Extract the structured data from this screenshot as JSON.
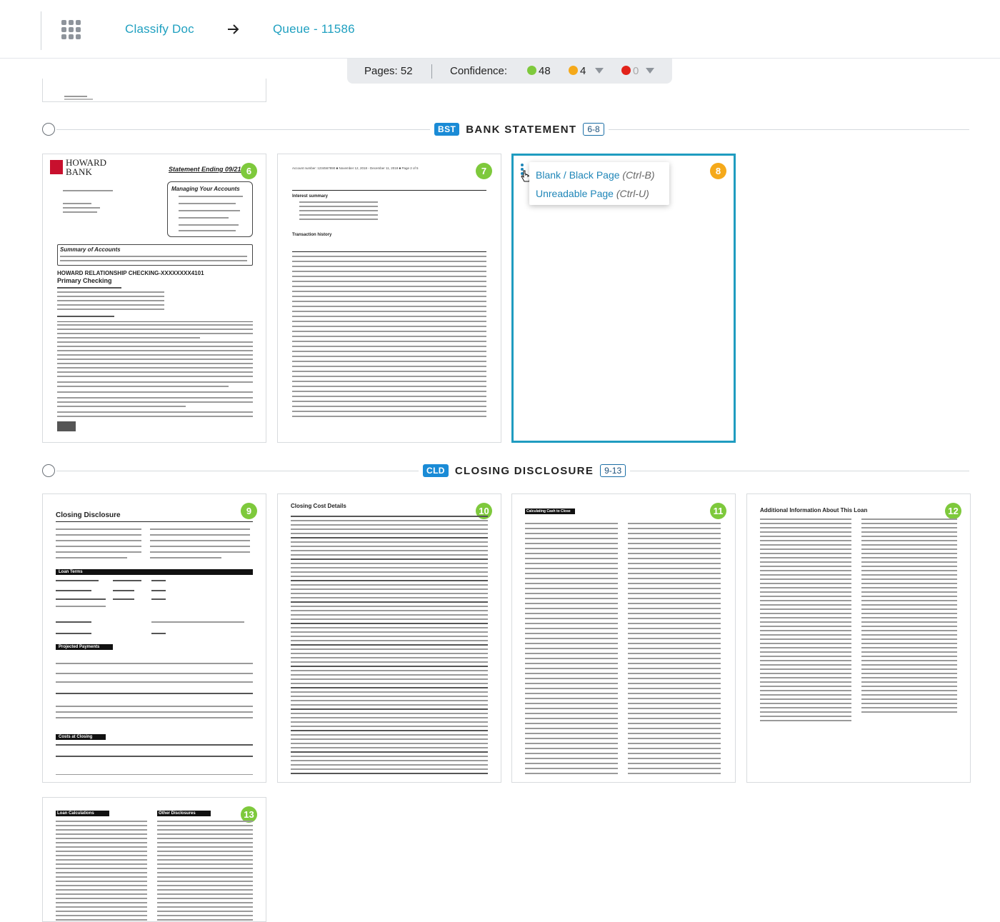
{
  "header": {
    "breadcrumb_1": "Classify Doc",
    "breadcrumb_2": "Queue - 11586"
  },
  "status": {
    "pages_label": "Pages: 52",
    "confidence_label": "Confidence:",
    "green_count": "48",
    "orange_count": "4",
    "red_count": "0",
    "colors": {
      "green": "#7ec93c",
      "orange": "#f5a91a",
      "red": "#e2231a"
    }
  },
  "sections": [
    {
      "code": "BST",
      "title": "BANK STATEMENT",
      "range": "6-8"
    },
    {
      "code": "CLD",
      "title": "CLOSING DISCLOSURE",
      "range": "9-13"
    }
  ],
  "pages": {
    "p6": "6",
    "p7": "7",
    "p8": "8",
    "p9": "9",
    "p10": "10",
    "p11": "11",
    "p12": "12",
    "p13": "13"
  },
  "context_menu": {
    "item1_label": "Blank / Black Page",
    "item1_shortcut": "(Ctrl-B)",
    "item2_label": "Unreadable Page",
    "item2_shortcut": "(Ctrl-U)"
  },
  "thumb_text": {
    "p6_bank": "HOWARD",
    "p6_bank2": "BANK",
    "p6_title": "Statement Ending 09/21/2",
    "p6_manage": "Managing Your Accounts",
    "p6_summary": "Summary of Accounts",
    "p6_checking": "HOWARD RELATIONSHIP CHECKING-XXXXXXXX4101",
    "p6_primary": "Primary Checking",
    "p7_header": "Account number: 1234567890  ■  November 12, 2018 - December 11, 2018  ■  Page 2 of 5",
    "p7_interest": "Interest summary",
    "p7_history": "Transaction history",
    "p9_title": "Closing Disclosure",
    "p9_loan_terms": "Loan Terms",
    "p9_projected": "Projected Payments",
    "p9_costs": "Costs at Closing",
    "p10_title": "Closing Cost Details",
    "p11_title": "Calculating Cash to Close",
    "p12_title": "Additional Information About This Loan",
    "p13_title": "Loan Calculations",
    "p13_title2": "Other Disclosures"
  }
}
